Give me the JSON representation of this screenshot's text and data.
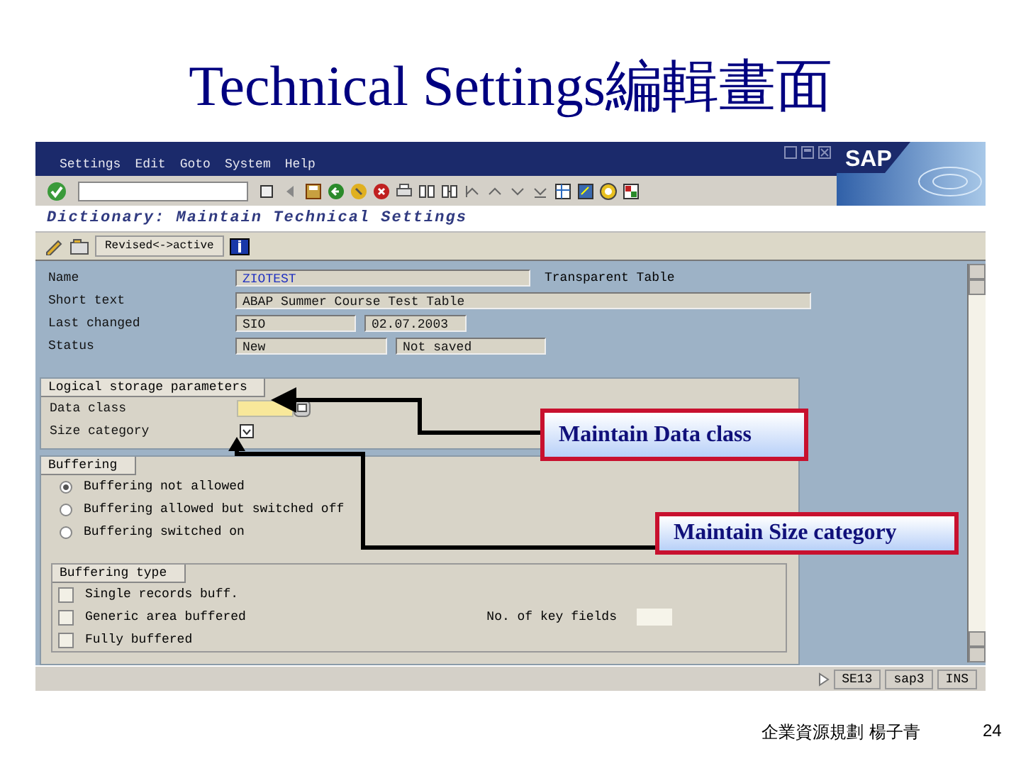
{
  "slide": {
    "title": "Technical Settings編輯畫面",
    "footer": "企業資源規劃 楊子青",
    "page_number": "24"
  },
  "window": {
    "menu": [
      "Settings",
      "Edit",
      "Goto",
      "System",
      "Help"
    ],
    "logo": "SAP",
    "title": "Dictionary: Maintain Technical Settings",
    "app_button": "Revised<->active"
  },
  "header_fields": [
    {
      "label": "Name",
      "value": "ZIOTEST",
      "note": "Transparent Table"
    },
    {
      "label": "Short text",
      "value": "ABAP Summer Course Test Table"
    },
    {
      "label": "Last changed",
      "value": "SIO",
      "value_2": "02.07.2003"
    },
    {
      "label": "Status",
      "value": "New",
      "value_2": "Not saved"
    }
  ],
  "logical_storage": {
    "title": "Logical storage parameters",
    "fields": [
      {
        "label": "Data class",
        "kind": "input"
      },
      {
        "label": "Size category",
        "kind": "picker"
      }
    ]
  },
  "buffering": {
    "title": "Buffering",
    "options": [
      {
        "label": "Buffering not allowed",
        "selected": true
      },
      {
        "label": "Buffering allowed but switched off",
        "selected": false
      },
      {
        "label": "Buffering switched on",
        "selected": false
      }
    ]
  },
  "buffering_type": {
    "title": "Buffering type",
    "options": [
      {
        "label": "Single records buff.",
        "checked": false
      },
      {
        "label": "Generic area buffered",
        "checked": false
      },
      {
        "label": "Fully buffered",
        "checked": false
      }
    ],
    "key_fields_label": "No. of key fields"
  },
  "status_bar": [
    "SE13",
    "sap3",
    "INS"
  ],
  "callouts": [
    {
      "text": "Maintain Data class"
    },
    {
      "text": "Maintain Size category"
    }
  ]
}
